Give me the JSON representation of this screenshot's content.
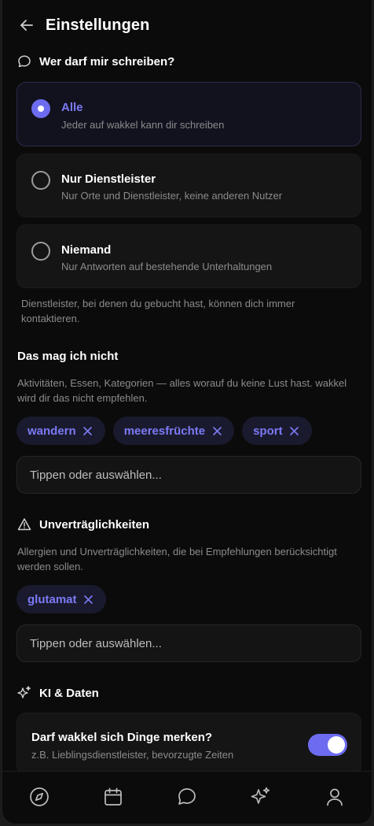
{
  "header": {
    "title": "Einstellungen",
    "back_icon": "arrow-left-icon"
  },
  "messaging": {
    "heading": "Wer darf mir schreiben?",
    "icon": "chat-bubble-icon",
    "options": [
      {
        "title": "Alle",
        "subtitle": "Jeder auf wakkel kann dir schreiben",
        "selected": true
      },
      {
        "title": "Nur Dienstleister",
        "subtitle": "Nur Orte und Dienstleister, keine anderen Nutzer",
        "selected": false
      },
      {
        "title": "Niemand",
        "subtitle": "Nur Antworten auf bestehende Unterhaltungen",
        "selected": false
      }
    ],
    "note": "Dienstleister, bei denen du gebucht hast, können dich immer kontaktieren."
  },
  "dislikes": {
    "heading": "Das mag ich nicht",
    "description": "Aktivitäten, Essen, Kategorien — alles worauf du keine Lust hast. wakkel wird dir das nicht empfehlen.",
    "tags": [
      "wandern",
      "meeresfrüchte",
      "sport"
    ],
    "input_placeholder": "Tippen oder auswählen..."
  },
  "intolerances": {
    "heading": "Unverträglichkeiten",
    "icon": "warning-triangle-icon",
    "description": "Allergien und Unverträglichkeiten, die bei Empfehlungen berücksichtigt werden sollen.",
    "tags": [
      "glutamat"
    ],
    "input_placeholder": "Tippen oder auswählen..."
  },
  "ai": {
    "heading": "KI & Daten",
    "icon": "sparkles-icon",
    "memory_title": "Darf wakkel sich Dinge merken?",
    "memory_subtitle": "z.B. Lieblingsdienstleister, bevorzugte Zeiten",
    "memory_enabled": true
  },
  "tabbar": {
    "items": [
      "compass-icon",
      "calendar-icon",
      "chat-bubble-icon",
      "sparkles-icon",
      "user-icon"
    ]
  },
  "colors": {
    "accent": "#6d6cf0",
    "accent_text": "#7b7af5",
    "background": "#0b0b0b",
    "surface": "#151515"
  }
}
